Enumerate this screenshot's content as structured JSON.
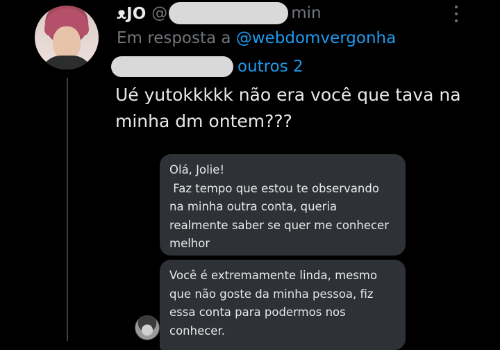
{
  "tweet": {
    "display_name": "ᴥJO",
    "handle_prefix": "@",
    "time_suffix": "min",
    "reply_prefix": "Em resposta a",
    "reply_mention": "@webdomvergonha",
    "reply_others": "outros 2",
    "text": "Ué yutokkkkk não era você que tava na minha dm ontem???"
  },
  "dm": {
    "message1": "Olá, Jolie!\n Faz tempo que estou te observando na minha outra conta, queria realmente saber se quer me conhecer melhor",
    "message2": "Você é extremamente linda, mesmo que não goste da minha pessoa, fiz essa conta para podermos nos conhecer."
  },
  "icons": {
    "more": "more-vertical-icon"
  },
  "colors": {
    "background": "#000000",
    "link": "#1d9bf0",
    "muted": "#71767b",
    "bubble": "#2e3236"
  }
}
